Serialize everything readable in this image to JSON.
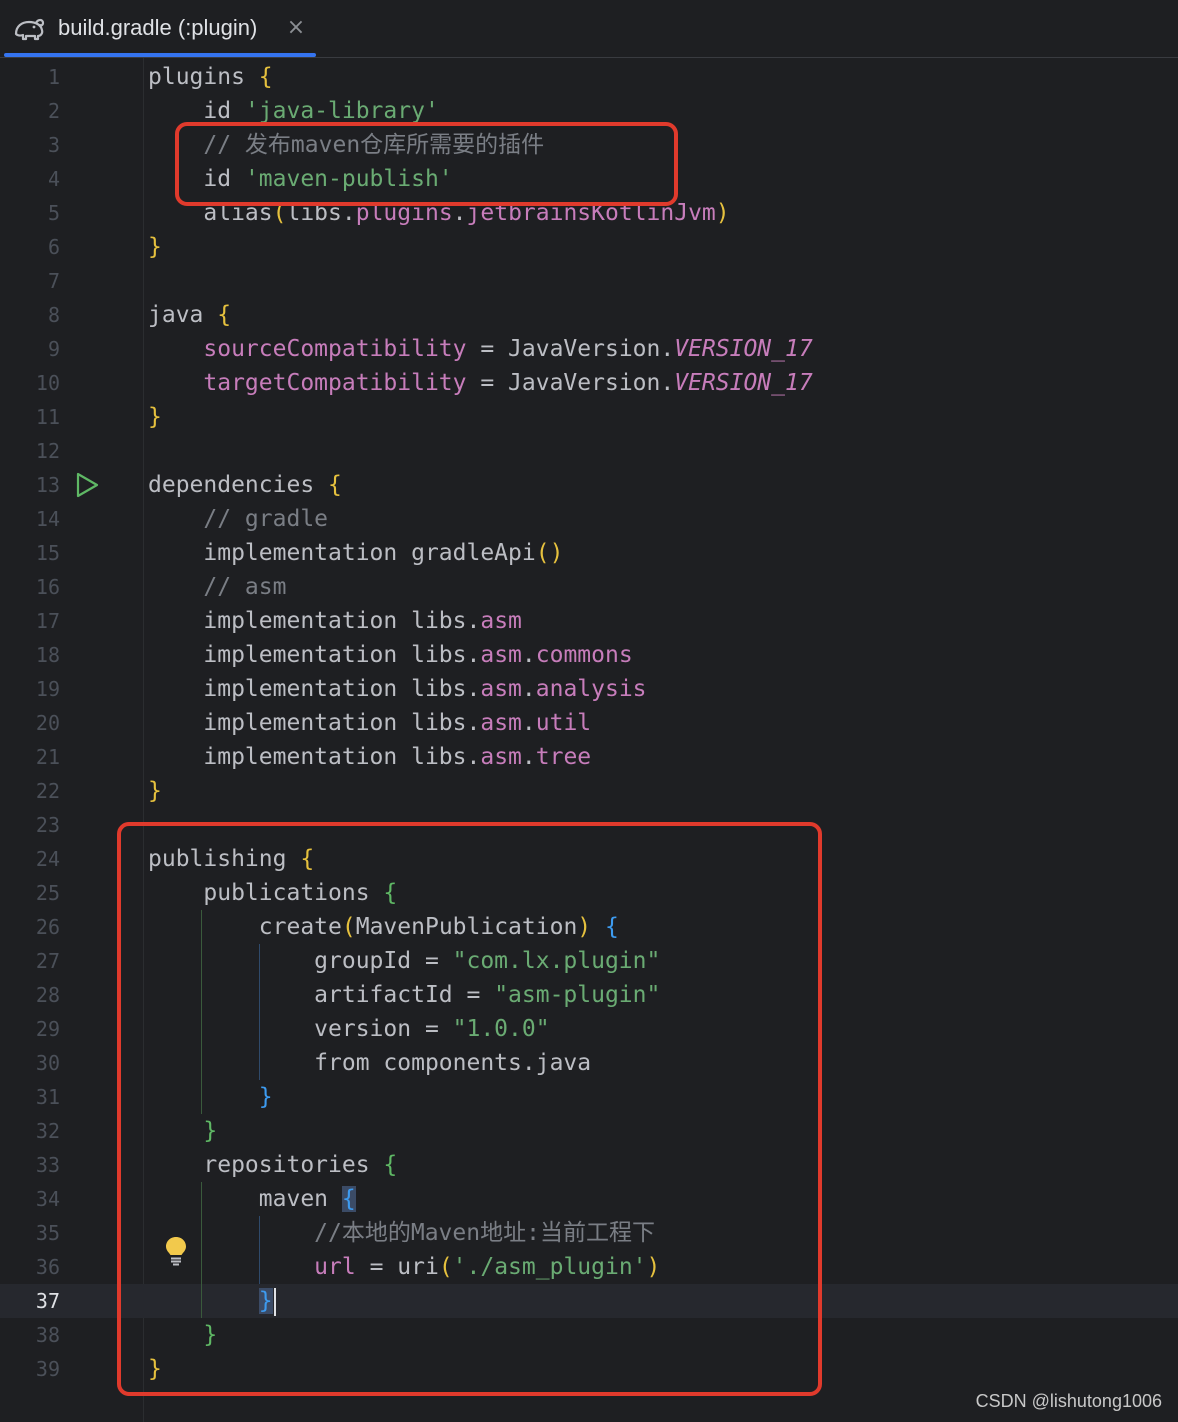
{
  "tab": {
    "icon": "gradle-elephant-icon",
    "title": "build.gradle (:plugin)",
    "close_glyph": "×"
  },
  "editor": {
    "current_line": 37,
    "lines": [
      {
        "n": "1",
        "tokens": [
          {
            "t": "plugins ",
            "c": "plain"
          },
          {
            "t": "{",
            "c": "b1"
          }
        ]
      },
      {
        "n": "2",
        "tokens": [
          {
            "t": "    id ",
            "c": "plain"
          },
          {
            "t": "'java-library'",
            "c": "str"
          }
        ]
      },
      {
        "n": "3",
        "tokens": [
          {
            "t": "    // 发布maven仓库所需要的插件",
            "c": "cmt"
          }
        ]
      },
      {
        "n": "4",
        "tokens": [
          {
            "t": "    id ",
            "c": "plain"
          },
          {
            "t": "'maven-publish'",
            "c": "str"
          }
        ]
      },
      {
        "n": "5",
        "tokens": [
          {
            "t": "    alias",
            "c": "plain"
          },
          {
            "t": "(",
            "c": "b1"
          },
          {
            "t": "libs.",
            "c": "plain"
          },
          {
            "t": "plugins",
            "c": "prop"
          },
          {
            "t": ".",
            "c": "plain"
          },
          {
            "t": "jetbrainsKotlinJvm",
            "c": "prop"
          },
          {
            "t": ")",
            "c": "b1"
          }
        ]
      },
      {
        "n": "6",
        "tokens": [
          {
            "t": "}",
            "c": "b1"
          }
        ]
      },
      {
        "n": "7",
        "tokens": []
      },
      {
        "n": "8",
        "tokens": [
          {
            "t": "java ",
            "c": "plain"
          },
          {
            "t": "{",
            "c": "b1"
          }
        ]
      },
      {
        "n": "9",
        "tokens": [
          {
            "t": "    ",
            "c": "plain"
          },
          {
            "t": "sourceCompatibility",
            "c": "prop"
          },
          {
            "t": " = JavaVersion.",
            "c": "plain"
          },
          {
            "t": "VERSION_17",
            "c": "const"
          }
        ]
      },
      {
        "n": "10",
        "tokens": [
          {
            "t": "    ",
            "c": "plain"
          },
          {
            "t": "targetCompatibility",
            "c": "prop"
          },
          {
            "t": " = JavaVersion.",
            "c": "plain"
          },
          {
            "t": "VERSION_17",
            "c": "const"
          }
        ]
      },
      {
        "n": "11",
        "tokens": [
          {
            "t": "}",
            "c": "b1"
          }
        ]
      },
      {
        "n": "12",
        "tokens": []
      },
      {
        "n": "13",
        "tokens": [
          {
            "t": "dependencies ",
            "c": "plain"
          },
          {
            "t": "{",
            "c": "b1"
          }
        ]
      },
      {
        "n": "14",
        "tokens": [
          {
            "t": "    // gradle",
            "c": "cmt"
          }
        ]
      },
      {
        "n": "15",
        "tokens": [
          {
            "t": "    implementation gradleApi",
            "c": "plain"
          },
          {
            "t": "()",
            "c": "b1"
          }
        ]
      },
      {
        "n": "16",
        "tokens": [
          {
            "t": "    // asm",
            "c": "cmt"
          }
        ]
      },
      {
        "n": "17",
        "tokens": [
          {
            "t": "    implementation libs.",
            "c": "plain"
          },
          {
            "t": "asm",
            "c": "prop"
          }
        ]
      },
      {
        "n": "18",
        "tokens": [
          {
            "t": "    implementation libs.",
            "c": "plain"
          },
          {
            "t": "asm",
            "c": "prop"
          },
          {
            "t": ".",
            "c": "plain"
          },
          {
            "t": "commons",
            "c": "prop"
          }
        ]
      },
      {
        "n": "19",
        "tokens": [
          {
            "t": "    implementation libs.",
            "c": "plain"
          },
          {
            "t": "asm",
            "c": "prop"
          },
          {
            "t": ".",
            "c": "plain"
          },
          {
            "t": "analysis",
            "c": "prop"
          }
        ]
      },
      {
        "n": "20",
        "tokens": [
          {
            "t": "    implementation libs.",
            "c": "plain"
          },
          {
            "t": "asm",
            "c": "prop"
          },
          {
            "t": ".",
            "c": "plain"
          },
          {
            "t": "util",
            "c": "prop"
          }
        ]
      },
      {
        "n": "21",
        "tokens": [
          {
            "t": "    implementation libs.",
            "c": "plain"
          },
          {
            "t": "asm",
            "c": "prop"
          },
          {
            "t": ".",
            "c": "plain"
          },
          {
            "t": "tree",
            "c": "prop"
          }
        ]
      },
      {
        "n": "22",
        "tokens": [
          {
            "t": "}",
            "c": "b1"
          }
        ]
      },
      {
        "n": "23",
        "tokens": []
      },
      {
        "n": "24",
        "tokens": [
          {
            "t": "publishing ",
            "c": "plain"
          },
          {
            "t": "{",
            "c": "b1"
          }
        ]
      },
      {
        "n": "25",
        "tokens": [
          {
            "t": "    publications ",
            "c": "plain"
          },
          {
            "t": "{",
            "c": "b2"
          }
        ]
      },
      {
        "n": "26",
        "tokens": [
          {
            "t": "        create",
            "c": "plain"
          },
          {
            "t": "(",
            "c": "b1"
          },
          {
            "t": "MavenPublication",
            "c": "plain"
          },
          {
            "t": ")",
            "c": "b1"
          },
          {
            "t": " ",
            "c": "plain"
          },
          {
            "t": "{",
            "c": "b3"
          }
        ]
      },
      {
        "n": "27",
        "tokens": [
          {
            "t": "            groupId = ",
            "c": "plain"
          },
          {
            "t": "\"com.lx.plugin\"",
            "c": "str"
          }
        ]
      },
      {
        "n": "28",
        "tokens": [
          {
            "t": "            artifactId = ",
            "c": "plain"
          },
          {
            "t": "\"asm-plugin\"",
            "c": "str"
          }
        ]
      },
      {
        "n": "29",
        "tokens": [
          {
            "t": "            version = ",
            "c": "plain"
          },
          {
            "t": "\"1.0.0\"",
            "c": "str"
          }
        ]
      },
      {
        "n": "30",
        "tokens": [
          {
            "t": "            from components.java",
            "c": "plain"
          }
        ]
      },
      {
        "n": "31",
        "tokens": [
          {
            "t": "        ",
            "c": "plain"
          },
          {
            "t": "}",
            "c": "b3"
          }
        ]
      },
      {
        "n": "32",
        "tokens": [
          {
            "t": "    ",
            "c": "plain"
          },
          {
            "t": "}",
            "c": "b2"
          }
        ]
      },
      {
        "n": "33",
        "tokens": [
          {
            "t": "    repositories ",
            "c": "plain"
          },
          {
            "t": "{",
            "c": "b2"
          }
        ]
      },
      {
        "n": "34",
        "tokens": [
          {
            "t": "        maven ",
            "c": "plain"
          },
          {
            "t": "{",
            "c": "b3sel"
          }
        ]
      },
      {
        "n": "35",
        "tokens": [
          {
            "t": "            //本地的Maven地址:当前工程下",
            "c": "cmt"
          }
        ]
      },
      {
        "n": "36",
        "tokens": [
          {
            "t": "            ",
            "c": "plain"
          },
          {
            "t": "url",
            "c": "prop"
          },
          {
            "t": " = uri",
            "c": "plain"
          },
          {
            "t": "(",
            "c": "b1"
          },
          {
            "t": "'./asm_plugin'",
            "c": "str"
          },
          {
            "t": ")",
            "c": "b1"
          }
        ]
      },
      {
        "n": "37",
        "tokens": [
          {
            "t": "        ",
            "c": "plain"
          },
          {
            "t": "}",
            "c": "b3sel"
          }
        ],
        "caret": true
      },
      {
        "n": "38",
        "tokens": [
          {
            "t": "    ",
            "c": "plain"
          },
          {
            "t": "}",
            "c": "b2"
          }
        ]
      },
      {
        "n": "39",
        "tokens": [
          {
            "t": "}",
            "c": "b1"
          }
        ]
      }
    ]
  },
  "gutter_icons": {
    "run_line": "13",
    "run_icon": "run-gutter-icon",
    "bulb_line": "36",
    "bulb_icon": "lightbulb-icon"
  },
  "colors": {
    "background": "#1e1f22",
    "accent_tab": "#3574f0",
    "string": "#6aab73",
    "comment": "#7a7e85",
    "property": "#c77dbb",
    "brace_level1": "#e6c13e",
    "brace_level2": "#5fb865",
    "brace_level3": "#3d9bf0",
    "annotation_box": "#e03a2c"
  },
  "watermark": "CSDN @lishutong1006"
}
